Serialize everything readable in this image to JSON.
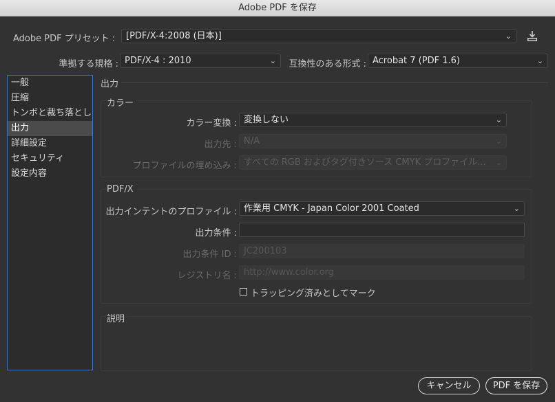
{
  "window": {
    "title": "Adobe PDF を保存"
  },
  "preset": {
    "label": "Adobe PDF プリセット :",
    "value": "[PDF/X-4:2008 (日本)]"
  },
  "standard": {
    "label": "準拠する規格 :",
    "value": "PDF/X-4 : 2010"
  },
  "compat": {
    "label": "互換性のある形式 :",
    "value": "Acrobat 7 (PDF 1.6)"
  },
  "sidebar": {
    "items": [
      {
        "label": "一般"
      },
      {
        "label": "圧縮"
      },
      {
        "label": "トンボと裁ち落とし"
      },
      {
        "label": "出力"
      },
      {
        "label": "詳細設定"
      },
      {
        "label": "セキュリティ"
      },
      {
        "label": "設定内容"
      }
    ],
    "selected": "出力"
  },
  "section": {
    "title": "出力"
  },
  "color": {
    "title": "カラー",
    "conversion": {
      "label": "カラー変換 :",
      "value": "変換しない"
    },
    "destination": {
      "label": "出力先 :",
      "value": "N/A"
    },
    "profile_inclusion": {
      "label": "プロファイルの埋め込み :",
      "value": "すべての RGB およびタグ付きソース CMYK プロファイル..."
    }
  },
  "pdfx": {
    "title": "PDF/X",
    "intent_profile": {
      "label": "出力インテントのプロファイル :",
      "value": "作業用 CMYK - Japan Color 2001 Coated"
    },
    "condition": {
      "label": "出力条件 :",
      "value": ""
    },
    "condition_id": {
      "label": "出力条件 ID :",
      "value": "JC200103"
    },
    "registry": {
      "label": "レジストリ名 :",
      "value": "http://www.color.org"
    },
    "trapped": {
      "label": "トラッピング済みとしてマーク",
      "checked": false
    }
  },
  "description": {
    "title": "説明"
  },
  "buttons": {
    "cancel": "キャンセル",
    "save": "PDF を保存"
  },
  "icons": {
    "chevron": "⌄",
    "save_preset": "download-icon"
  }
}
